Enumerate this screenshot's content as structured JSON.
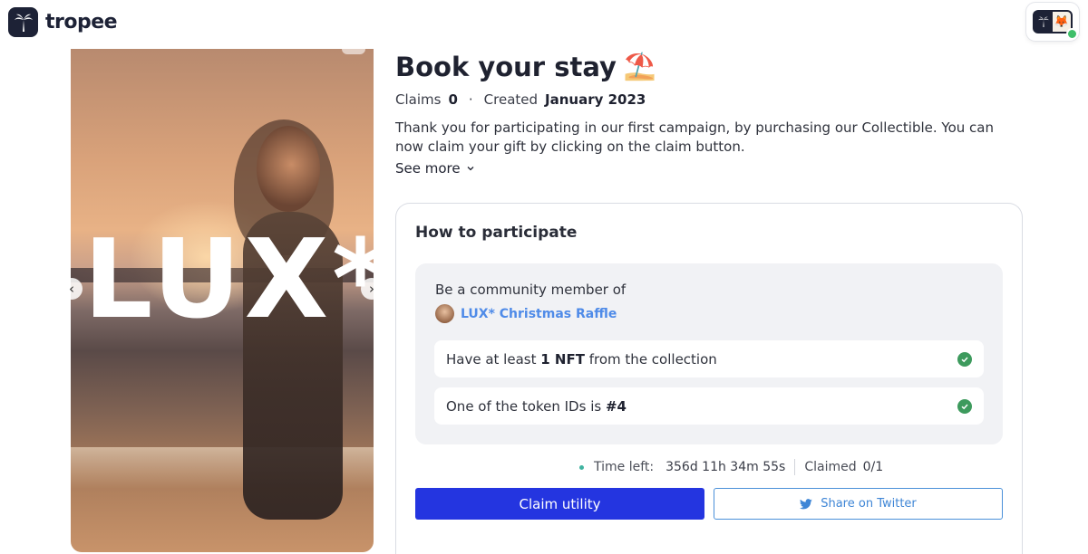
{
  "header": {
    "brand": "tropee"
  },
  "hero": {
    "overlay_text": "LUX*"
  },
  "page": {
    "title": "Book your stay",
    "title_emoji": "⛱️",
    "claims_label": "Claims",
    "claims_count": "0",
    "created_label": "Created",
    "created_date": "January 2023",
    "description": "Thank you for participating in our first campaign, by purchasing our Collectible. You can now claim your gift by clicking on the claim button.",
    "see_more": "See more"
  },
  "participate": {
    "title": "How to participate",
    "community_label": "Be a community member of",
    "community_name": "LUX* Christmas Raffle",
    "req1_prefix": "Have at least",
    "req1_bold": "1 NFT",
    "req1_suffix": "from the collection",
    "req2_prefix": "One of the token IDs is",
    "req2_bold": "#4",
    "time_left_label": "Time left:",
    "time_left_value": "356d 11h 34m 55s",
    "claimed_label": "Claimed",
    "claimed_value": "0/1",
    "claim_button": "Claim utility",
    "share_button": "Share on Twitter"
  },
  "colors": {
    "primary_button": "#2435e0",
    "twitter_blue": "#3f86d6",
    "check_green": "#3d9a5d",
    "link_blue": "#4f8be8"
  }
}
